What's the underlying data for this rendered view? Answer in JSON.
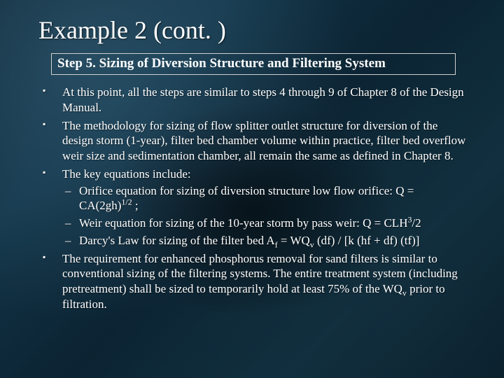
{
  "title": "Example 2 (cont. )",
  "step_heading": "Step 5. Sizing of Diversion Structure and Filtering System",
  "bullets": {
    "b1": "At this point, all the steps are similar to steps 4 through 9 of Chapter 8 of the Design Manual.",
    "b2": "The methodology for sizing of flow splitter outlet structure for diversion of the design storm (1-year), filter bed chamber volume within practice, filter bed overflow weir size and sedimentation chamber, all remain the same as defined in Chapter 8.",
    "b3": "The key equations include:",
    "b4_pre": "The requirement for enhanced phosphorus removal for sand filters is similar to conventional sizing of the filtering systems. The entire treatment system (including pretreatment) shall be sized to temporarily hold at least 75% of the WQ",
    "b4_sub": "v",
    "b4_post": " prior to filtration."
  },
  "sub": {
    "s1_pre": "Orifice equation for sizing of diversion structure low flow orifice: Q = CA(2gh)",
    "s1_sup": "1/2",
    "s1_post": " ;",
    "s2_pre": "Weir equation for sizing of the 10-year storm by pass weir: Q = CLH",
    "s2_sup": "3",
    "s2_post": "/2",
    "s3_a": "Darcy's Law for sizing of the filter bed  A",
    "s3_b": " = WQ",
    "s3_c": " (df) / [k (hf + df) (tf)]",
    "s3_sub1": "f",
    "s3_sub2": "v"
  }
}
